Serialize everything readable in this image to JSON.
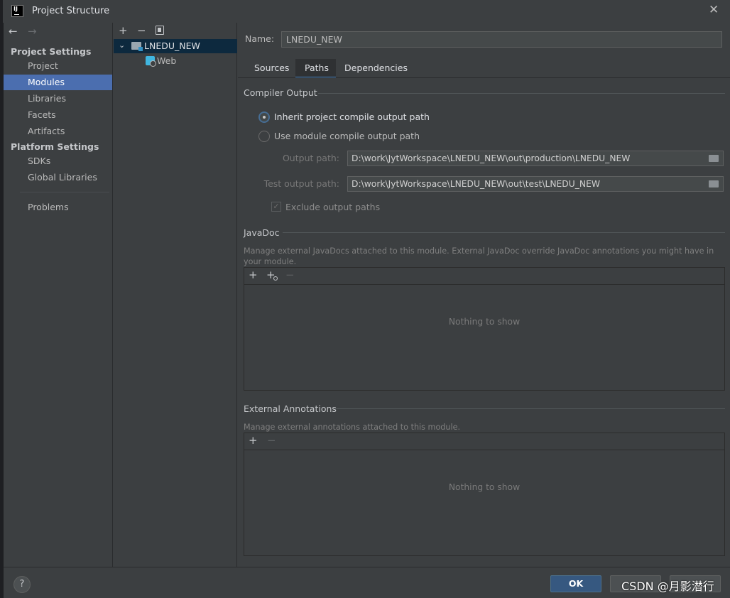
{
  "window": {
    "title": "Project Structure",
    "app_icon_text": "IJ"
  },
  "nav": {
    "back": "←",
    "forward": "→"
  },
  "sidebar": {
    "project_settings": "Project Settings",
    "project_items": [
      {
        "label": "Project"
      },
      {
        "label": "Modules",
        "selected": true
      },
      {
        "label": "Libraries"
      },
      {
        "label": "Facets"
      },
      {
        "label": "Artifacts"
      }
    ],
    "platform_settings": "Platform Settings",
    "platform_items": [
      {
        "label": "SDKs"
      },
      {
        "label": "Global Libraries"
      }
    ],
    "problems": "Problems"
  },
  "tree": {
    "toolbar": {
      "add": "+",
      "remove": "−"
    },
    "root": {
      "label": "LNEDU_NEW",
      "expanded": true
    },
    "child": {
      "label": "Web"
    }
  },
  "module": {
    "name_label": "Name:",
    "name_value": "LNEDU_NEW",
    "tabs": [
      {
        "label": "Sources"
      },
      {
        "label": "Paths",
        "selected": true
      },
      {
        "label": "Dependencies"
      }
    ]
  },
  "compiler_output": {
    "title": "Compiler Output",
    "inherit_label": "Inherit project compile output path",
    "use_module_label": "Use module compile output path",
    "selected": "inherit",
    "output_label": "Output path:",
    "output_value": "D:\\work\\JytWorkspace\\LNEDU_NEW\\out\\production\\LNEDU_NEW",
    "test_output_label": "Test output path:",
    "test_output_value": "D:\\work\\JytWorkspace\\LNEDU_NEW\\out\\test\\LNEDU_NEW",
    "exclude_label": "Exclude output paths",
    "exclude_checked": true
  },
  "javadoc": {
    "title": "JavaDoc",
    "description": "Manage external JavaDocs attached to this module. External JavaDoc override JavaDoc annotations you might have in your module.",
    "toolbar": {
      "add": "+",
      "add_url": "+",
      "remove": "−"
    },
    "empty": "Nothing to show"
  },
  "external_annotations": {
    "title": "External Annotations",
    "description": "Manage external annotations attached to this module.",
    "toolbar": {
      "add": "+",
      "remove": "−"
    },
    "empty": "Nothing to show"
  },
  "footer": {
    "help": "?",
    "ok": "OK",
    "watermark": "CSDN @月影潜行"
  },
  "colors": {
    "accent": "#4b6eaf",
    "ok_button": "#365880",
    "background": "#3c3f41",
    "tab_underline": "#4a88c7"
  }
}
